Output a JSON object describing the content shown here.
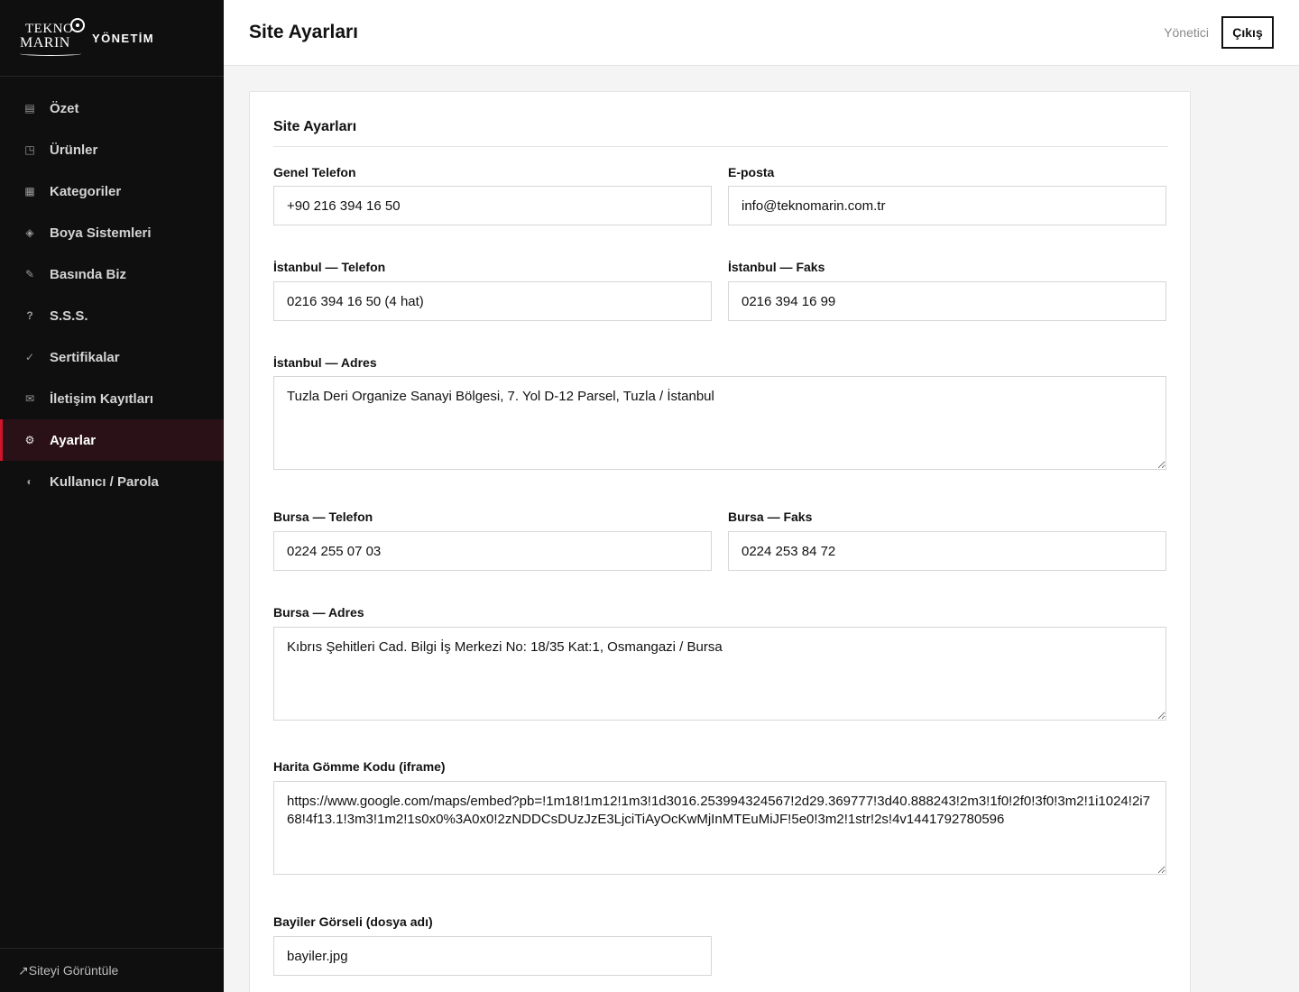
{
  "brand": {
    "logo_top": "TEKNO",
    "logo_bottom": "MARIN",
    "title": "YÖNETİM"
  },
  "sidebar": {
    "items": [
      {
        "label": "Özet",
        "icon": "▤",
        "icon_name": "dashboard-icon",
        "active": false
      },
      {
        "label": "Ürünler",
        "icon": "◳",
        "icon_name": "products-icon",
        "active": false
      },
      {
        "label": "Kategoriler",
        "icon": "▦",
        "icon_name": "categories-icon",
        "active": false
      },
      {
        "label": "Boya Sistemleri",
        "icon": "◈",
        "icon_name": "paint-systems-icon",
        "active": false
      },
      {
        "label": "Basında Biz",
        "icon": "✎",
        "icon_name": "press-icon",
        "active": false
      },
      {
        "label": "S.S.S.",
        "icon": "?",
        "icon_name": "faq-icon",
        "active": false
      },
      {
        "label": "Sertifikalar",
        "icon": "✓",
        "icon_name": "certificates-icon",
        "active": false
      },
      {
        "label": "İletişim Kayıtları",
        "icon": "✉",
        "icon_name": "messages-icon",
        "active": false
      },
      {
        "label": "Ayarlar",
        "icon": "⚙",
        "icon_name": "settings-icon",
        "active": true
      },
      {
        "label": "Kullanıcı / Parola",
        "icon": "◐",
        "icon_name": "user-icon",
        "active": false
      }
    ],
    "footer": {
      "icon": "↗",
      "label": "Siteyi Görüntüle"
    }
  },
  "header": {
    "title": "Site Ayarları",
    "user": "Yönetici",
    "logout_label": "Çıkış"
  },
  "form": {
    "section_title": "Site Ayarları",
    "fields": {
      "general_phone": {
        "label": "Genel Telefon",
        "value": "+90 216 394 16 50"
      },
      "email": {
        "label": "E-posta",
        "value": "info@teknomarin.com.tr"
      },
      "istanbul_phone": {
        "label": "İstanbul — Telefon",
        "value": "0216 394 16 50 (4 hat)"
      },
      "istanbul_fax": {
        "label": "İstanbul — Faks",
        "value": "0216 394 16 99"
      },
      "istanbul_address": {
        "label": "İstanbul — Adres",
        "value": "Tuzla Deri Organize Sanayi Bölgesi, 7. Yol D-12 Parsel, Tuzla / İstanbul"
      },
      "bursa_phone": {
        "label": "Bursa — Telefon",
        "value": "0224 255 07 03"
      },
      "bursa_fax": {
        "label": "Bursa — Faks",
        "value": "0224 253 84 72"
      },
      "bursa_address": {
        "label": "Bursa — Adres",
        "value": "Kıbrıs Şehitleri Cad. Bilgi İş Merkezi No: 18/35 Kat:1, Osmangazi / Bursa"
      },
      "map_embed": {
        "label": "Harita Gömme Kodu (iframe)",
        "value": "https://www.google.com/maps/embed?pb=!1m18!1m12!1m3!1d3016.253994324567!2d29.369777!3d40.888243!2m3!1f0!2f0!3f0!3m2!1i1024!2i768!4f13.1!3m3!1m2!1s0x0%3A0x0!2zNDDCsDUzJzE3LjciTiAyOcKwMjInMTEuMiJF!5e0!3m2!1str!2s!4v1441792780596"
      },
      "dealers_image": {
        "label": "Bayiler Görseli (dosya adı)",
        "value": "bayiler.jpg"
      }
    }
  }
}
